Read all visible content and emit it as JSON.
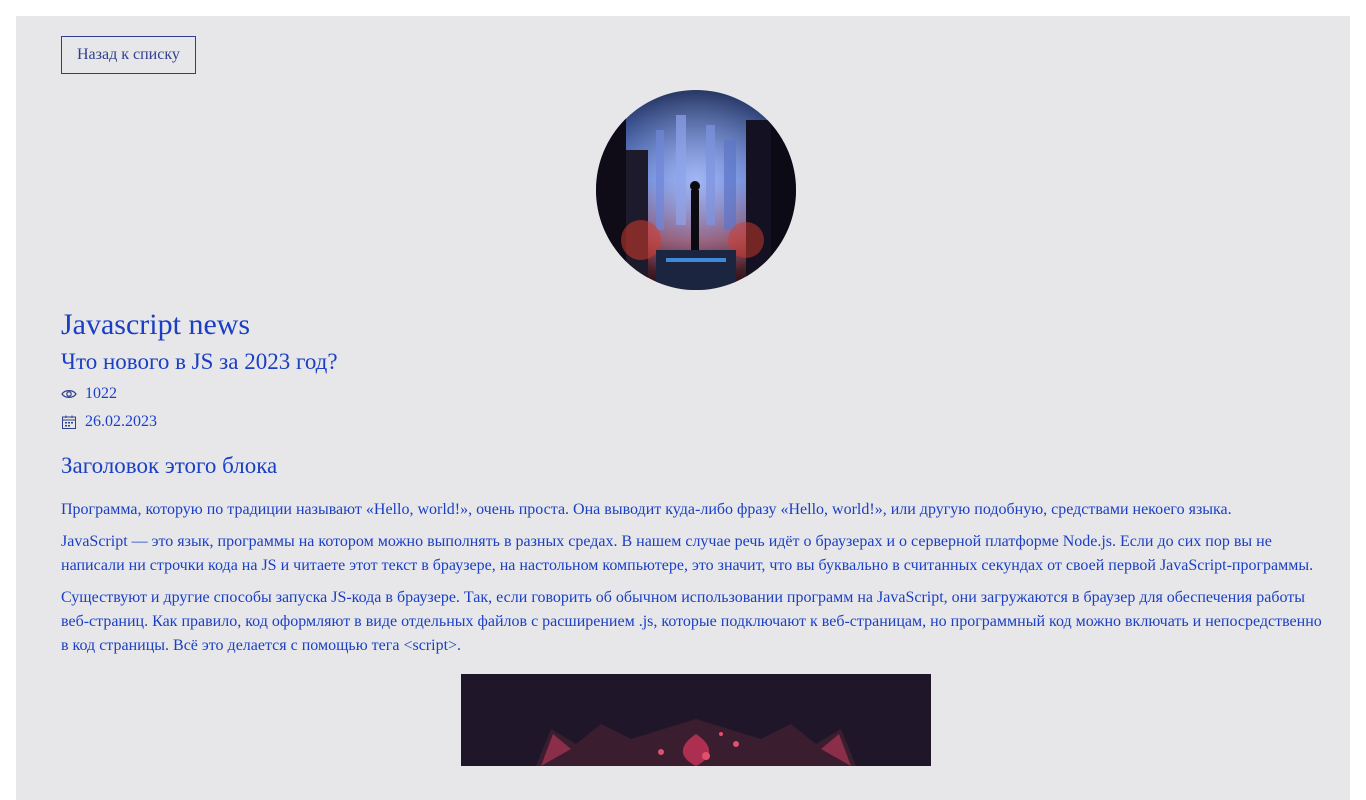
{
  "nav": {
    "back_label": "Назад к списку"
  },
  "article": {
    "title": "Javascript news",
    "subtitle": "Что нового в JS за 2023 год?",
    "views": "1022",
    "date": "26.02.2023",
    "block_heading": "Заголовок этого блока",
    "paragraphs": [
      "Программа, которую по традиции называют «Hello, world!», очень проста. Она выводит куда-либо фразу «Hello, world!», или другую подобную, средствами некоего языка.",
      "JavaScript — это язык, программы на котором можно выполнять в разных средах. В нашем случае речь идёт о браузерах и о серверной платформе Node.js. Если до сих пор вы не написали ни строчки кода на JS и читаете этот текст в браузере, на настольном компьютере, это значит, что вы буквально в считанных секундах от своей первой JavaScript-программы.",
      "Существуют и другие способы запуска JS-кода в браузере. Так, если говорить об обычном использовании программ на JavaScript, они загружаются в браузер для обеспечения работы веб-страниц. Как правило, код оформляют в виде отдельных файлов с расширением .js, которые подключают к веб-страницам, но программный код можно включать и непосредственно в код страницы. Всё это делается с помощью тега <script>."
    ]
  },
  "icons": {
    "views": "eye-icon",
    "date": "calendar-icon"
  },
  "colors": {
    "text": "#1a3fc4",
    "background": "#e7e7ea",
    "button_border": "#2e3f8e"
  }
}
